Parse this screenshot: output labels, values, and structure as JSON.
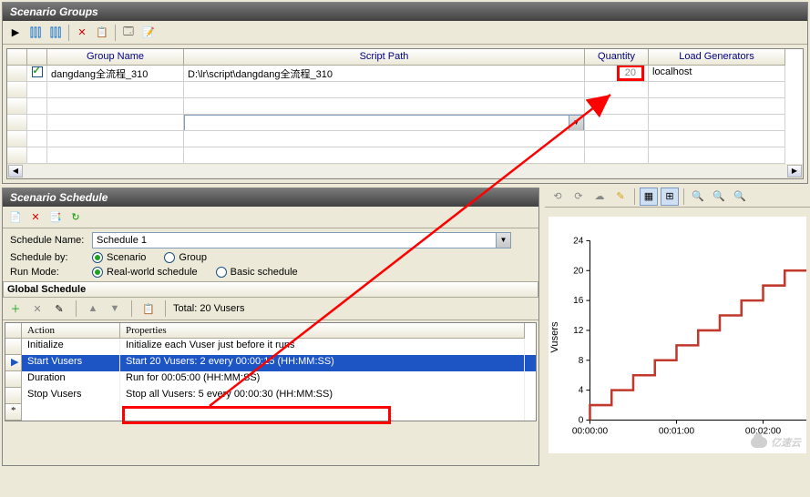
{
  "scenario_groups": {
    "title": "Scenario Groups",
    "columns": {
      "group_name": "Group Name",
      "script_path": "Script Path",
      "quantity": "Quantity",
      "load_generators": "Load Generators"
    },
    "rows": [
      {
        "checked": true,
        "group_name": "dangdang全流程_310",
        "script_path": "D:\\lr\\script\\dangdang全流程_310",
        "quantity": "20",
        "load_generators": "localhost"
      }
    ]
  },
  "scenario_schedule": {
    "title": "Scenario Schedule",
    "schedule_name_label": "Schedule Name:",
    "schedule_name_value": "Schedule 1",
    "schedule_by_label": "Schedule by:",
    "schedule_by_options": {
      "scenario": "Scenario",
      "group": "Group"
    },
    "run_mode_label": "Run Mode:",
    "run_mode_options": {
      "real": "Real-world schedule",
      "basic": "Basic schedule"
    }
  },
  "global_schedule": {
    "title": "Global Schedule",
    "total_label": "Total: 20 Vusers",
    "columns": {
      "action": "Action",
      "properties": "Properties"
    },
    "rows": [
      {
        "action": "Initialize",
        "properties": "Initialize each Vuser just before it runs"
      },
      {
        "action": "Start Vusers",
        "properties": "Start 20 Vusers: 2 every 00:00:15 (HH:MM:SS)"
      },
      {
        "action": "Duration",
        "properties": "Run for 00:05:00 (HH:MM:SS)"
      },
      {
        "action": "Stop Vusers",
        "properties": "Stop all Vusers: 5 every 00:00:30 (HH:MM:SS)"
      }
    ],
    "star": "*"
  },
  "chart_data": {
    "type": "line",
    "ylabel": "Vusers",
    "xlabel": "",
    "ylim": [
      0,
      24
    ],
    "yticks": [
      0,
      4,
      8,
      12,
      16,
      20,
      24
    ],
    "xticks": [
      "00:00:00",
      "00:01:00",
      "00:02:00"
    ],
    "series": [
      {
        "name": "Vusers",
        "x_seconds": [
          0,
          15,
          30,
          45,
          60,
          75,
          90,
          105,
          120,
          135,
          300
        ],
        "values": [
          2,
          4,
          6,
          8,
          10,
          12,
          14,
          16,
          18,
          20,
          20
        ]
      }
    ]
  },
  "watermark": "亿速云",
  "icons": {
    "play": "▶",
    "chevron_down": "▼",
    "chevron_left": "◀",
    "chevron_right": "▶",
    "add": "+",
    "delete": "✕",
    "edit": "✎",
    "up": "▲",
    "down": "▼",
    "zoom_in": "🔍+",
    "zoom_out": "🔍-",
    "zoom_fit": "🔍"
  }
}
